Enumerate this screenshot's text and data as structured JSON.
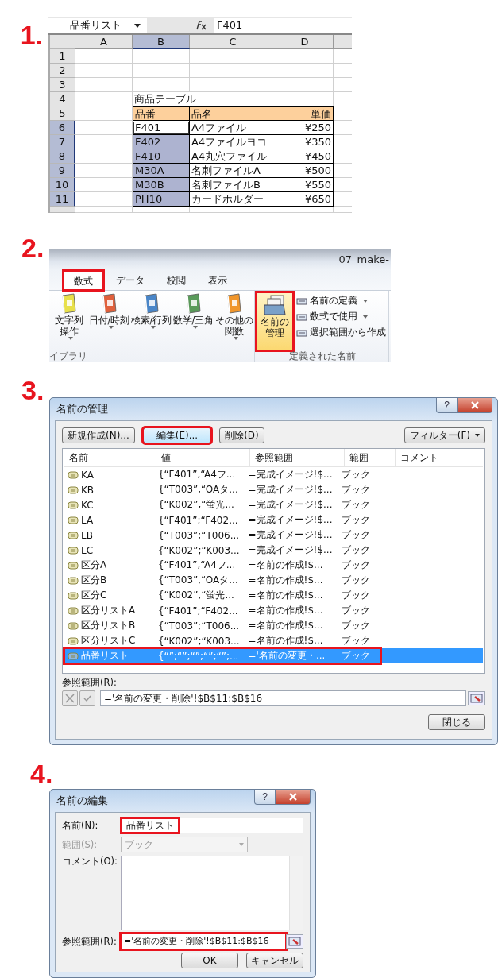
{
  "step1": {
    "label": "1.",
    "name_box": "品番リスト",
    "formula": "F401",
    "columns": [
      {
        "label": "A",
        "selected": false
      },
      {
        "label": "B",
        "selected": true
      },
      {
        "label": "C",
        "selected": false
      },
      {
        "label": "D",
        "selected": false
      }
    ],
    "rows": [
      {
        "number": "1",
        "kind": "blank",
        "selected": false,
        "active": false
      },
      {
        "number": "2",
        "kind": "blank",
        "selected": false,
        "active": false
      },
      {
        "number": "3",
        "kind": "blank",
        "selected": false,
        "active": false
      },
      {
        "number": "4",
        "kind": "title",
        "selected": false,
        "active": false,
        "b": "商品テーブル"
      },
      {
        "number": "5",
        "kind": "header",
        "selected": false,
        "active": false,
        "b": "品番",
        "c": "品名",
        "d": "単価"
      },
      {
        "number": "6",
        "kind": "data",
        "selected": true,
        "active": true,
        "b": "F401",
        "c": "A4ファイル",
        "d": "¥250"
      },
      {
        "number": "7",
        "kind": "data",
        "selected": true,
        "active": false,
        "b": "F402",
        "c": "A4ファイルヨコ",
        "d": "¥350"
      },
      {
        "number": "8",
        "kind": "data",
        "selected": true,
        "active": false,
        "b": "F410",
        "c": "A4丸穴ファイル",
        "d": "¥450"
      },
      {
        "number": "9",
        "kind": "data",
        "selected": true,
        "active": false,
        "b": "M30A",
        "c": "名刺ファイルA",
        "d": "¥500"
      },
      {
        "number": "10",
        "kind": "data",
        "selected": true,
        "active": false,
        "b": "M30B",
        "c": "名刺ファイルB",
        "d": "¥550"
      },
      {
        "number": "11",
        "kind": "data",
        "selected": true,
        "active": false,
        "b": "PH10",
        "c": "カードホルダー",
        "d": "¥650"
      }
    ]
  },
  "step2": {
    "label": "2.",
    "title": "07_make-",
    "tabs": [
      {
        "label": "数式",
        "selected": true,
        "highlighted": true
      },
      {
        "label": "データ",
        "selected": false,
        "highlighted": false
      },
      {
        "label": "校閲",
        "selected": false,
        "highlighted": false
      },
      {
        "label": "表示",
        "selected": false,
        "highlighted": false
      }
    ],
    "library_buttons": [
      {
        "lines": [
          "文字列",
          "操作"
        ],
        "dropdown": true
      },
      {
        "lines": [
          "日付/時刻"
        ],
        "dropdown": true
      },
      {
        "lines": [
          "検索/行列"
        ],
        "dropdown": true
      },
      {
        "lines": [
          "数学/三角"
        ],
        "dropdown": true
      },
      {
        "lines": [
          "その他の",
          "関数"
        ],
        "dropdown": true
      }
    ],
    "library_label": "イブラリ",
    "manage_button": {
      "lines": [
        "名前の",
        "管理"
      ],
      "highlighted": true
    },
    "name_commands": [
      {
        "label": "名前の定義",
        "dropdown": true
      },
      {
        "label": "数式で使用",
        "dropdown": true
      },
      {
        "label": "選択範囲から作成",
        "dropdown": false
      }
    ],
    "group_label": "定義された名前"
  },
  "step3": {
    "label": "3.",
    "title": "名前の管理",
    "help_button": "?",
    "buttons": [
      {
        "label": "新規作成(N)...",
        "kind": "action",
        "highlighted": false,
        "dropdown": false
      },
      {
        "label": "編集(E)...",
        "kind": "action",
        "highlighted": true,
        "dropdown": false
      },
      {
        "label": "削除(D)",
        "kind": "action",
        "highlighted": false,
        "dropdown": false
      },
      {
        "label": "フィルター(F)",
        "kind": "filter",
        "highlighted": false,
        "dropdown": true
      }
    ],
    "columns": [
      "名前",
      "値",
      "参照範囲",
      "範囲",
      "コメント"
    ],
    "rows": [
      {
        "name": "KA",
        "value": "{“F401”,“A4フ...",
        "ref": "=完成イメージ!$...",
        "scope": "ブック",
        "selected": false,
        "highlighted": false
      },
      {
        "name": "KB",
        "value": "{“T003”,“OAタ...",
        "ref": "=完成イメージ!$...",
        "scope": "ブック",
        "selected": false,
        "highlighted": false
      },
      {
        "name": "KC",
        "value": "{“K002”,“蛍光...",
        "ref": "=完成イメージ!$...",
        "scope": "ブック",
        "selected": false,
        "highlighted": false
      },
      {
        "name": "LA",
        "value": "{“F401”;“F402...",
        "ref": "=完成イメージ!$...",
        "scope": "ブック",
        "selected": false,
        "highlighted": false
      },
      {
        "name": "LB",
        "value": "{“T003”;“T006...",
        "ref": "=完成イメージ!$...",
        "scope": "ブック",
        "selected": false,
        "highlighted": false
      },
      {
        "name": "LC",
        "value": "{“K002”;“K003...",
        "ref": "=完成イメージ!$...",
        "scope": "ブック",
        "selected": false,
        "highlighted": false
      },
      {
        "name": "区分A",
        "value": "{“F401”,“A4フ...",
        "ref": "=名前の作成!$...",
        "scope": "ブック",
        "selected": false,
        "highlighted": false
      },
      {
        "name": "区分B",
        "value": "{“T003”,“OAタ...",
        "ref": "=名前の作成!$...",
        "scope": "ブック",
        "selected": false,
        "highlighted": false
      },
      {
        "name": "区分C",
        "value": "{“K002”,“蛍光...",
        "ref": "=名前の作成!$...",
        "scope": "ブック",
        "selected": false,
        "highlighted": false
      },
      {
        "name": "区分リストA",
        "value": "{“F401”;“F402...",
        "ref": "=名前の作成!$...",
        "scope": "ブック",
        "selected": false,
        "highlighted": false
      },
      {
        "name": "区分リストB",
        "value": "{“T003”;“T006...",
        "ref": "=名前の作成!$...",
        "scope": "ブック",
        "selected": false,
        "highlighted": false
      },
      {
        "name": "区分リストC",
        "value": "{“K002”;“K003...",
        "ref": "=名前の作成!$...",
        "scope": "ブック",
        "selected": false,
        "highlighted": false
      },
      {
        "name": "品番リスト",
        "value": "{“”;“”;“”;“”;“”;...",
        "ref": "='名前の変更・...",
        "scope": "ブック",
        "selected": true,
        "highlighted": true
      }
    ],
    "ref_label": "参照範囲(R):",
    "ref_value": "='名前の変更・削除'!$B$11:$B$16",
    "close_button": "閉じる"
  },
  "step4": {
    "label": "4.",
    "title": "名前の編集",
    "help_button": "?",
    "name_label": "名前(N):",
    "name_value": "品番リスト",
    "name_highlighted": true,
    "scope_label": "範囲(S):",
    "scope_value": "ブック",
    "scope_disabled": true,
    "comment_label": "コメント(O):",
    "ref_label": "参照範囲(R):",
    "ref_value": "='名前の変更・削除'!$B$11:$B$16",
    "ref_highlighted": true,
    "ok_button": "OK",
    "cancel_button": "キャンセル"
  }
}
